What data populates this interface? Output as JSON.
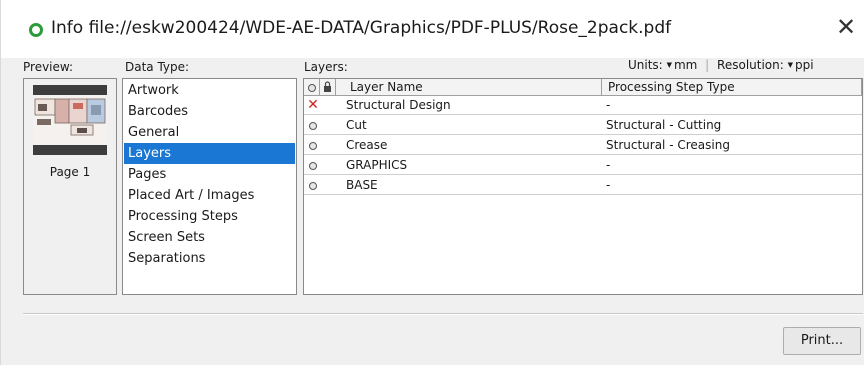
{
  "window": {
    "title": "Info file://eskw200424/WDE-AE-DATA/Graphics/PDF-PLUS/Rose_2pack.pdf",
    "close_symbol": "✕",
    "status_icon": "status-circle-icon",
    "status_color": "#2e9b3b"
  },
  "preview": {
    "label": "Preview:",
    "page_label": "Page 1"
  },
  "data_type": {
    "label": "Data Type:",
    "items": [
      "Artwork",
      "Barcodes",
      "General",
      "Layers",
      "Pages",
      "Placed Art / Images",
      "Processing Steps",
      "Screen Sets",
      "Separations"
    ],
    "selected": "Layers",
    "selected_color": "#1a78d4"
  },
  "layers": {
    "label": "Layers:",
    "units_label": "Units:",
    "units_value": "mm",
    "resolution_label": "Resolution:",
    "resolution_value": "ppi",
    "columns": {
      "visibility": "visibility-icon",
      "lock": "lock-icon",
      "name": "Layer Name",
      "step": "Processing Step Type"
    },
    "rows": [
      {
        "visibility": "hidden-x-icon",
        "name": "Structural Design",
        "step": "-"
      },
      {
        "visibility": "visible-icon",
        "name": "Cut",
        "step": "Structural - Cutting"
      },
      {
        "visibility": "visible-icon",
        "name": "Crease",
        "step": "Structural - Creasing"
      },
      {
        "visibility": "visible-icon",
        "name": "GRAPHICS",
        "step": "-"
      },
      {
        "visibility": "visible-icon",
        "name": "BASE",
        "step": "-"
      }
    ]
  },
  "footer": {
    "print_label": "Print..."
  }
}
